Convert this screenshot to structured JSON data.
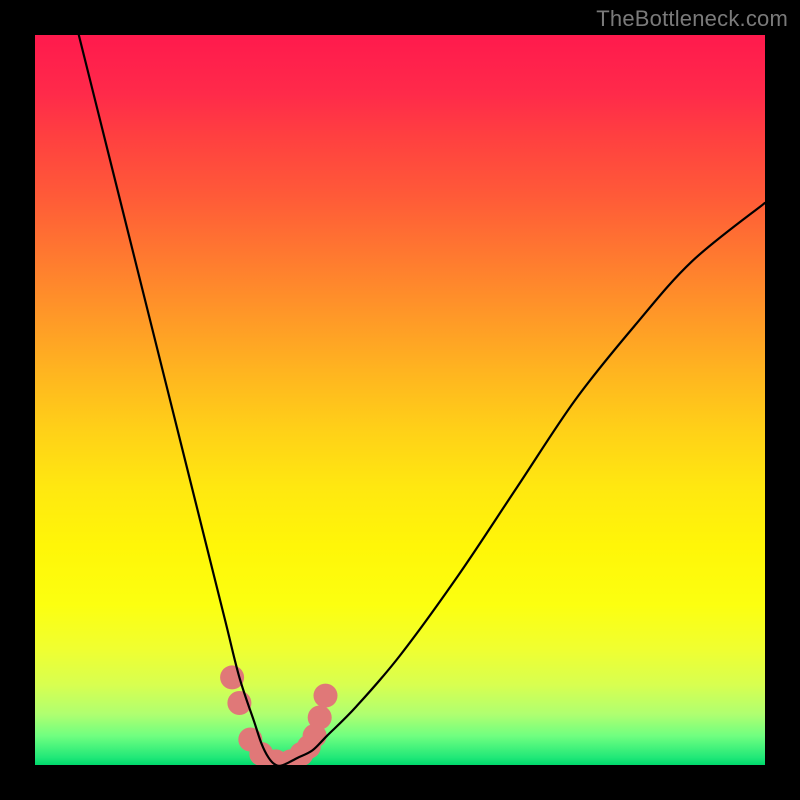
{
  "watermark": "TheBottleneck.com",
  "chart_data": {
    "type": "line",
    "title": "",
    "xlabel": "",
    "ylabel": "",
    "xlim": [
      0,
      100
    ],
    "ylim": [
      0,
      100
    ],
    "grid": false,
    "legend": false,
    "series": [
      {
        "name": "bottleneck-curve",
        "x": [
          6,
          10,
          14,
          18,
          22,
          26,
          28,
          30,
          31,
          32,
          33,
          34,
          36,
          38,
          40,
          44,
          50,
          58,
          66,
          74,
          82,
          90,
          100
        ],
        "values": [
          100,
          84,
          68,
          52,
          36,
          20,
          12,
          6,
          3,
          1,
          0,
          0,
          1,
          2,
          4,
          8,
          15,
          26,
          38,
          50,
          60,
          69,
          77
        ]
      }
    ],
    "markers": {
      "name": "highlight-dots",
      "x": [
        27.0,
        28.0,
        29.5,
        31.0,
        33.0,
        35.0,
        36.5,
        37.5,
        38.3,
        39.0,
        39.8
      ],
      "values": [
        12.0,
        8.5,
        3.5,
        1.5,
        0.5,
        0.5,
        1.5,
        2.5,
        4.0,
        6.5,
        9.5
      ],
      "color": "#e07878",
      "radius": 12
    },
    "background": {
      "type": "vertical-gradient",
      "stops": [
        {
          "pos": 0.0,
          "color": "#ff1a4d"
        },
        {
          "pos": 0.5,
          "color": "#ffc81c"
        },
        {
          "pos": 0.78,
          "color": "#fcff10"
        },
        {
          "pos": 0.96,
          "color": "#70ff80"
        },
        {
          "pos": 1.0,
          "color": "#00d86c"
        }
      ]
    }
  }
}
